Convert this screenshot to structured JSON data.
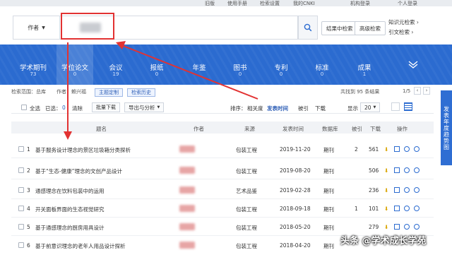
{
  "topbar": {
    "links": [
      "旧版",
      "使用手册",
      "检索设置",
      "我的CNKI",
      "机构登录",
      "个人登录"
    ]
  },
  "search": {
    "field": "作者",
    "actions": [
      "结果中检索",
      "高级检索"
    ],
    "side_links": [
      "知识元检索",
      "引文检索"
    ]
  },
  "categories": [
    {
      "label": "学术期刊",
      "count": "73"
    },
    {
      "label": "学位论文",
      "count": "0"
    },
    {
      "label": "会议",
      "count": "19"
    },
    {
      "label": "报纸",
      "count": "0"
    },
    {
      "label": "年鉴",
      "count": ""
    },
    {
      "label": "图书",
      "count": "0"
    },
    {
      "label": "专利",
      "count": "0"
    },
    {
      "label": "标准",
      "count": "0"
    },
    {
      "label": "成果",
      "count": "1"
    }
  ],
  "scope": {
    "label": "检索范围：总库",
    "query": "作者：赖兴福",
    "tags": [
      "主题定制",
      "检索历史"
    ],
    "result_count": "共找到 95 条结果",
    "page": "1/5"
  },
  "toolbar": {
    "select_all": "全选",
    "selected": "已选：",
    "selected_count": "0",
    "clear": "清除",
    "batch_download": "批量下载",
    "export": "导出与分析",
    "sort_label": "排序：",
    "sort_options": [
      "相关度",
      "发表时间",
      "被引",
      "下载"
    ],
    "show_label": "显示",
    "page_size": "20"
  },
  "columns": [
    "题名",
    "作者",
    "来源",
    "发表时间",
    "数据库",
    "被引",
    "下载",
    "操作"
  ],
  "rows": [
    {
      "idx": "1",
      "title": "基于服务设计理念的景区垃圾箱分类探析",
      "source": "包装工程",
      "date": "2019-11-20",
      "db": "期刊",
      "cited": "2",
      "downloads": "561"
    },
    {
      "idx": "2",
      "title": "基于“生态-健康”理念的文创产品设计",
      "source": "包装工程",
      "date": "2019-08-20",
      "db": "期刊",
      "cited": "",
      "downloads": "506"
    },
    {
      "idx": "3",
      "title": "通感理念在饮料包装中的运用",
      "source": "艺术品鉴",
      "date": "2019-02-28",
      "db": "期刊",
      "cited": "",
      "downloads": "236"
    },
    {
      "idx": "4",
      "title": "开关面板界面的生态视觉研究",
      "source": "包装工程",
      "date": "2018-09-18",
      "db": "期刊",
      "cited": "1",
      "downloads": "101"
    },
    {
      "idx": "5",
      "title": "基于通感理念的厨房用具设计",
      "source": "包装工程",
      "date": "2018-05-20",
      "db": "期刊",
      "cited": "",
      "downloads": "279"
    },
    {
      "idx": "6",
      "title": "基于前意识理念的老年人用品设计探析",
      "source": "包装工程",
      "date": "2018-04-20",
      "db": "期刊",
      "cited": "",
      "downloads": ""
    }
  ],
  "float_panel": "发表年度趋势图",
  "watermark": "头条 @学术成长学苑",
  "colors": {
    "brand_blue": "#2b6bd0",
    "annotation_red": "#e23232"
  }
}
